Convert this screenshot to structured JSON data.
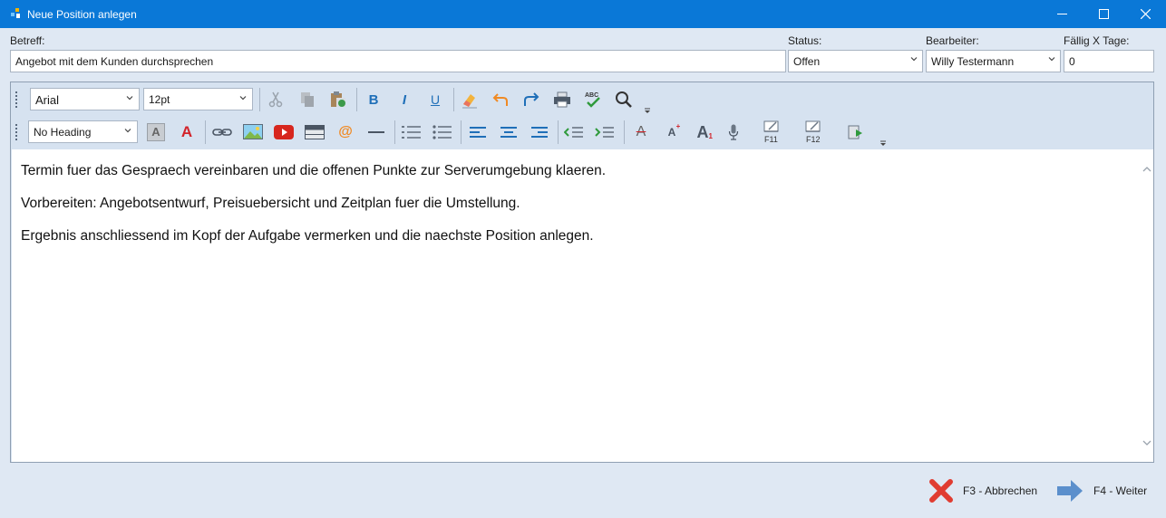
{
  "window": {
    "title": "Neue Position anlegen",
    "controls": [
      "minimize-icon",
      "maximize-icon",
      "close-icon"
    ]
  },
  "form": {
    "betreff": {
      "label": "Betreff:",
      "value": "Angebot mit dem Kunden durchsprechen"
    },
    "status": {
      "label": "Status:",
      "value": "Offen"
    },
    "bearbeiter": {
      "label": "Bearbeiter:",
      "value": "Willy Testermann"
    },
    "faellig": {
      "label": "Fällig X Tage:",
      "value": "0"
    }
  },
  "toolbar": {
    "font_family": "Arial",
    "font_size": "12pt",
    "heading_style": "No Heading",
    "row1_icons": [
      "cut-icon",
      "copy-icon",
      "paste-icon",
      "bold-icon",
      "italic-icon",
      "underline-icon",
      "eraser-icon",
      "undo-icon",
      "redo-icon",
      "print-icon",
      "spellcheck-icon",
      "find-icon"
    ],
    "row2_icons": [
      "highlight-color-icon",
      "font-color-icon",
      "link-icon",
      "image-icon",
      "video-icon",
      "table-icon",
      "email-icon",
      "horizontal-rule-icon",
      "numbered-list-icon",
      "bullet-list-icon",
      "align-left-icon",
      "align-center-icon",
      "align-right-icon",
      "outdent-icon",
      "indent-icon",
      "strikethrough-icon",
      "superscript-icon",
      "subscript-icon",
      "microphone-icon",
      "f11-icon",
      "f12-icon",
      "insert-icon"
    ],
    "text": {
      "bold": "B",
      "italic": "I",
      "underline": "U",
      "abc": "ABC",
      "highlight": "A",
      "font_color": "A",
      "email": "@",
      "strike": "A",
      "superscript": "A",
      "superscript_mark": "+",
      "subscript": "A",
      "subscript_mark": "1",
      "f11": "F11",
      "f12": "F12"
    }
  },
  "editor": {
    "paragraphs": [
      "Termin fuer das Gespraech vereinbaren und die offenen Punkte zur Serverumgebung klaeren.",
      "Vorbereiten: Angebotsentwurf, Preisuebersicht und Zeitplan fuer die Umstellung.",
      "Ergebnis anschliessend im Kopf der Aufgabe vermerken und die naechste Position anlegen."
    ]
  },
  "actions": {
    "cancel": "F3 - Abbrechen",
    "next": "F4 - Weiter"
  },
  "colors": {
    "titlebar": "#0a78d7",
    "background": "#dfe8f3",
    "toolbar": "#d6e2f0",
    "accent_blue": "#1f6fb8",
    "red": "#d2232a"
  }
}
